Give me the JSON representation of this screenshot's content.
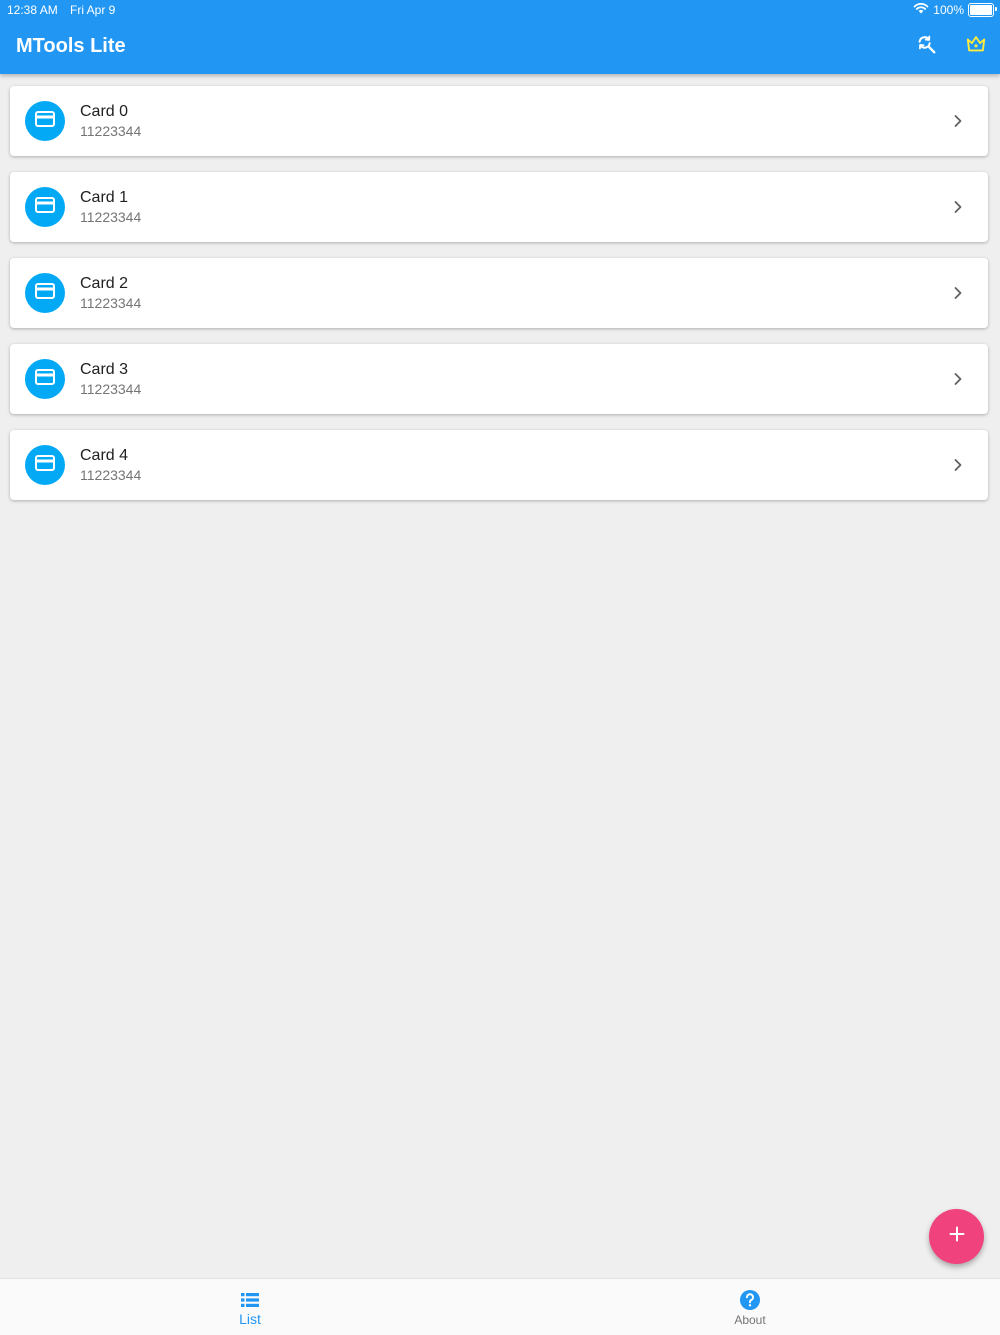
{
  "status_bar": {
    "time": "12:38 AM",
    "date": "Fri Apr 9",
    "battery": "100%"
  },
  "app_bar": {
    "title": "MTools Lite",
    "background": "#2196f3",
    "actions": [
      {
        "icon": "search-refresh-icon"
      },
      {
        "icon": "crown-icon",
        "color": "#ffeb3b"
      }
    ]
  },
  "cards": [
    {
      "title": "Card 0",
      "number": "11223344",
      "icon": "credit-card-icon"
    },
    {
      "title": "Card 1",
      "number": "11223344",
      "icon": "credit-card-icon"
    },
    {
      "title": "Card 2",
      "number": "11223344",
      "icon": "credit-card-icon"
    },
    {
      "title": "Card 3",
      "number": "11223344",
      "icon": "credit-card-icon"
    },
    {
      "title": "Card 4",
      "number": "11223344",
      "icon": "credit-card-icon"
    }
  ],
  "fab": {
    "icon": "plus-icon",
    "color": "#f0437e"
  },
  "bottom_nav": {
    "items": [
      {
        "label": "List",
        "icon": "list-icon",
        "active": true
      },
      {
        "label": "About",
        "icon": "help-icon",
        "active": false
      }
    ],
    "active_color": "#2196f3"
  }
}
